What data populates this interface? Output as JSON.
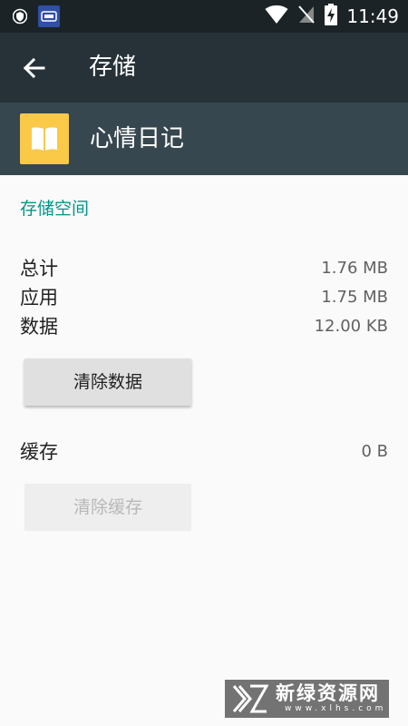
{
  "status_bar": {
    "time": "11:49",
    "icons": [
      "shield-icon",
      "notification-app-icon",
      "wifi-icon",
      "no-sim-icon",
      "battery-charging-icon"
    ]
  },
  "toolbar": {
    "title": "存储",
    "back_icon": "arrow-back-icon"
  },
  "app": {
    "name": "心情日记",
    "icon": "book-icon",
    "icon_color": "#fbc948"
  },
  "storage": {
    "section_title": "存储空间",
    "rows": [
      {
        "label": "总计",
        "value": "1.76 MB"
      },
      {
        "label": "应用",
        "value": "1.75 MB"
      },
      {
        "label": "数据",
        "value": "12.00 KB"
      }
    ],
    "clear_data_label": "清除数据",
    "cache_label": "缓存",
    "cache_value": "0 B",
    "clear_cache_label": "清除缓存"
  },
  "watermark": {
    "text": "新绿资源网",
    "sub": "www.xlhs.com"
  },
  "colors": {
    "accent": "#009688",
    "toolbar": "#263238",
    "app_header": "#37474f",
    "status_bar": "#1b2326"
  }
}
